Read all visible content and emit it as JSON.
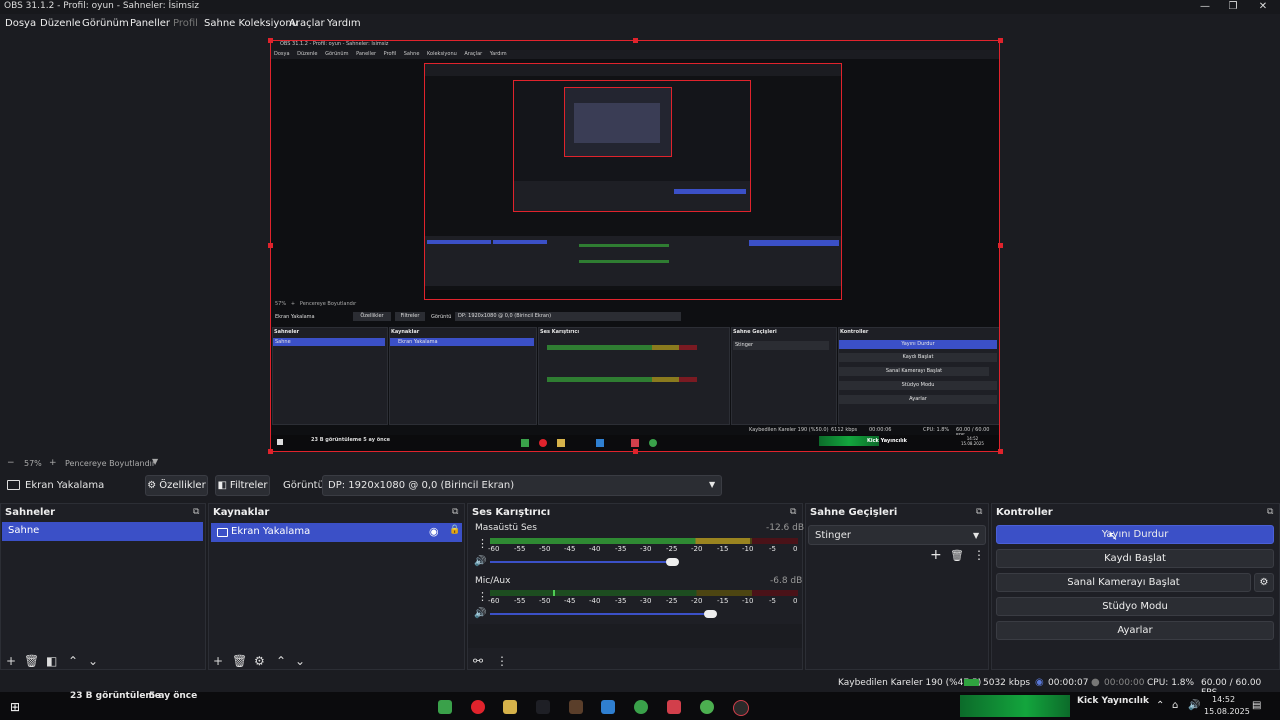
{
  "window": {
    "title": "OBS 31.1.2 - Profil: oyun - Sahneler: İsimsiz",
    "min": "—",
    "max": "❐",
    "close": "✕"
  },
  "menu": [
    "Dosya",
    "Düzenle",
    "Görünüm",
    "Paneller",
    "Profil",
    "Sahne Koleksiyonu",
    "Araçlar",
    "Yardım"
  ],
  "zoom": {
    "minus": "−",
    "percent": "57%",
    "plus": "+",
    "fit": "Pencereye Boyutlandır"
  },
  "source_bar": {
    "source_name": "Ekran Yakalama",
    "properties": "Özellikler",
    "filters": "Filtreler",
    "display_label": "Görüntü",
    "display_value": "DP: 1920x1080 @ 0,0 (Birincil Ekran)"
  },
  "scenes": {
    "title": "Sahneler",
    "items": [
      "Sahne"
    ]
  },
  "sources": {
    "title": "Kaynaklar",
    "items": [
      "Ekran Yakalama"
    ]
  },
  "mixer": {
    "title": "Ses Karıştırıcı",
    "channels": [
      {
        "name": "Masaüstü Ses",
        "db": "-12.6 dB",
        "level": 0.62,
        "volume": 0.95
      },
      {
        "name": "Mic/Aux",
        "db": "-6.8 dB",
        "level": 0.2,
        "volume": 0.8
      }
    ],
    "scale": [
      "-60",
      "-55",
      "-50",
      "-45",
      "-40",
      "-35",
      "-30",
      "-25",
      "-20",
      "-15",
      "-10",
      "-5",
      "0"
    ]
  },
  "transitions": {
    "title": "Sahne Geçişleri",
    "selected": "Stinger"
  },
  "controls": {
    "title": "Kontroller",
    "buttons": [
      "Yayını Durdur",
      "Kaydı Başlat",
      "Sanal Kamerayı Başlat",
      "Stüdyo Modu",
      "Ayarlar"
    ]
  },
  "status": {
    "dropped": "Kaybedilen Kareler 190 (%47.5)",
    "kbps": "5032 kbps",
    "stream_time": "00:00:07",
    "rec_time": "00:00:00",
    "cpu": "CPU: 1.8%",
    "fps": "60.00 / 60.00 FPS"
  },
  "taskbar": {
    "views": "23 B görüntüleme",
    "ago": "5 ay önce",
    "kick": "Kick Yayıncılık",
    "time": "14:52",
    "date": "15.08.2025"
  },
  "inner": {
    "title": "OBS 31.1.2 - Profil: oyun - Sahneler: İsimsiz",
    "zoom": "57%",
    "fit": "Pencereye Boyutlandır",
    "source_name": "Ekran Yakalama",
    "properties": "Özellikler",
    "filters": "Filtreler",
    "display_label": "Görüntü",
    "display_value": "DP: 1920x1080 @ 0,0 (Birincil Ekran)",
    "scene": "Sahne",
    "status_dropped": "Kaybedilen Kareler 190 (%50.0)",
    "status_kbps": "6112 kbps",
    "status_time": "00:00:06",
    "status_cpu": "CPU: 1.8%",
    "status_fps": "60.00 / 60.00 FPS",
    "views": "23 B görüntüleme",
    "ago": "5 ay önce",
    "kick": "Kick Yayıncılık",
    "time": "14:52",
    "date": "15.08.2025"
  },
  "colors": {
    "accent": "#3b50c7",
    "red": "#e0232c",
    "meter_green": "#2f7d32",
    "meter_yellow": "#8a7a1e",
    "meter_red": "#7a1a22"
  }
}
